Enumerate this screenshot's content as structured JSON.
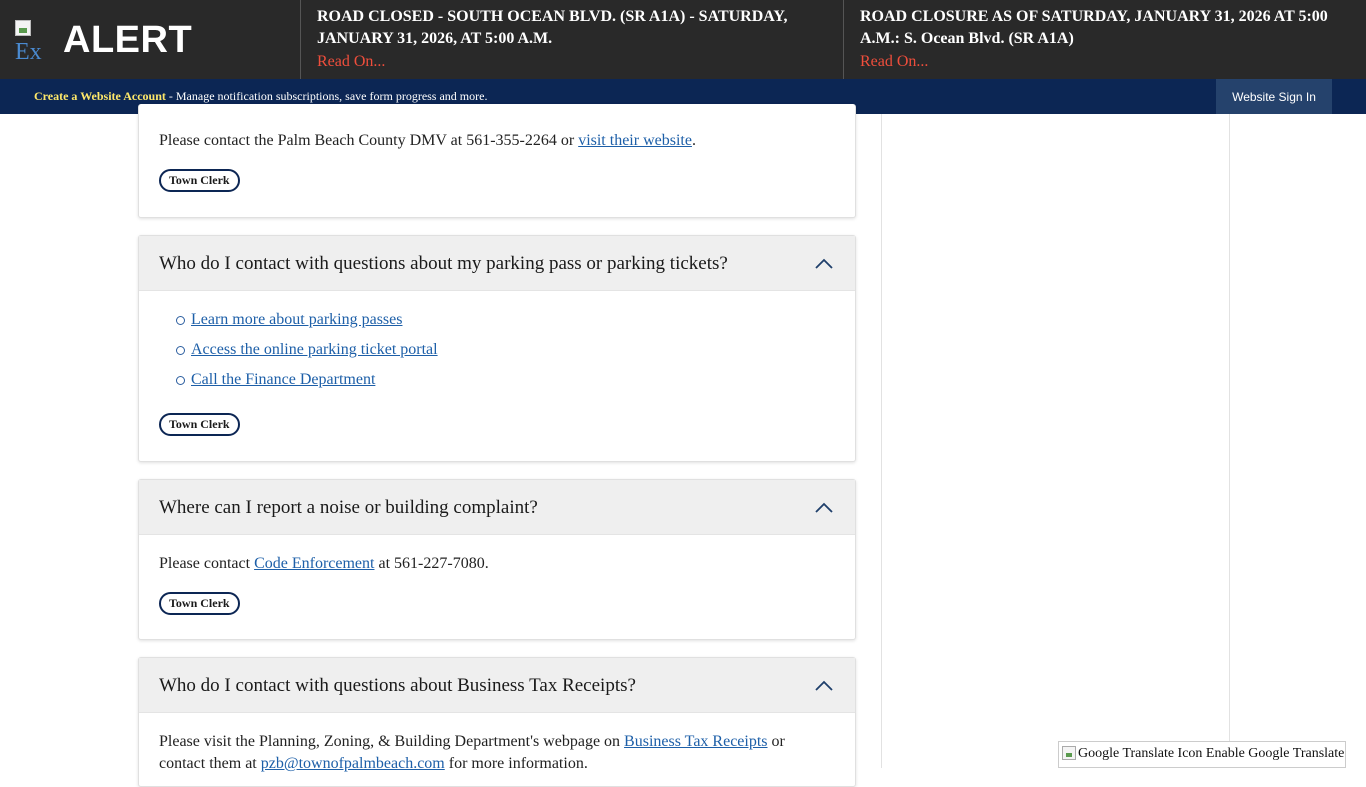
{
  "alert": {
    "title": "ALERT",
    "icon_alt": "Ex",
    "items": [
      {
        "headline": "ROAD CLOSED - SOUTH OCEAN BLVD. (SR A1A) - SATURDAY, JANUARY 31, 2026, AT 5:00 A.M.",
        "read_on": "Read On..."
      },
      {
        "headline": "ROAD CLOSURE AS OF SATURDAY, JANUARY 31, 2026 AT 5:00 A.M.: S. Ocean Blvd. (SR A1A)",
        "read_on": "Read On..."
      }
    ]
  },
  "account_bar": {
    "create_link": "Create a Website Account",
    "description": " - Manage notification subscriptions, save form progress and more.",
    "sign_in": "Website Sign In"
  },
  "faq": [
    {
      "body_prefix": "Please contact the Palm Beach County DMV at 561-355-2264 or ",
      "body_link": "visit their website",
      "body_suffix": ".",
      "tag": "Town Clerk"
    },
    {
      "question": "Who do I contact with questions about my parking pass or parking tickets?",
      "links": [
        "Learn more about parking passes",
        "Access the online parking ticket portal",
        "Call the Finance Department"
      ],
      "tag": "Town Clerk"
    },
    {
      "question": "Where can I report a noise or building complaint?",
      "body_prefix": "Please contact ",
      "body_link": "Code Enforcement",
      "body_suffix": " at 561-227-7080.",
      "tag": "Town Clerk"
    },
    {
      "question": "Who do I contact with questions about Business Tax Receipts?",
      "body_prefix": "Please visit the Planning, Zoning, & Building Department's webpage on ",
      "body_link": "Business Tax Receipts",
      "body_middle": " or contact them at ",
      "body_link2": "pzb@townofpalmbeach.com",
      "body_suffix": " for more information."
    }
  ],
  "google_translate": {
    "label": "Google Translate Icon Enable Google Translate"
  },
  "colors": {
    "alert_bg": "#292929",
    "account_bar_bg": "#0c2654",
    "read_on": "#ef4e3c",
    "link": "#1d5fa8",
    "create_link": "#ffe86a"
  }
}
